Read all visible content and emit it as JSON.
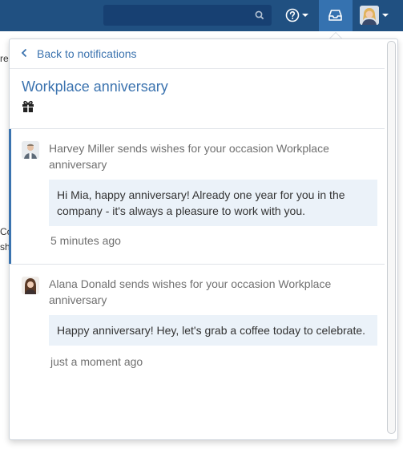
{
  "header": {
    "search_placeholder": "",
    "help_icon": "help-icon",
    "notifications_icon": "inbox-icon"
  },
  "background": {
    "frag_top": "re",
    "frag_mid1": "Co",
    "frag_mid2": "sh"
  },
  "panel": {
    "back_label": "Back to notifications",
    "title": "Workplace anniversary",
    "notifications": [
      {
        "message": "Harvey Miller sends wishes for your occasion Workplace anniversary",
        "quote": "Hi Mia, happy anniversary! Already one year for you in the company - it's always a pleasure to work with you.",
        "time": "5 minutes ago",
        "active": true
      },
      {
        "message": "Alana Donald sends wishes for your occasion Workplace anniversary",
        "quote": "Happy anniversary! Hey, let's grab a coffee today to celebrate.",
        "time": "just a moment ago",
        "active": false
      }
    ]
  },
  "colors": {
    "header_bg": "#205081",
    "accent": "#3b73af",
    "quote_bg": "#ebf2f9"
  }
}
